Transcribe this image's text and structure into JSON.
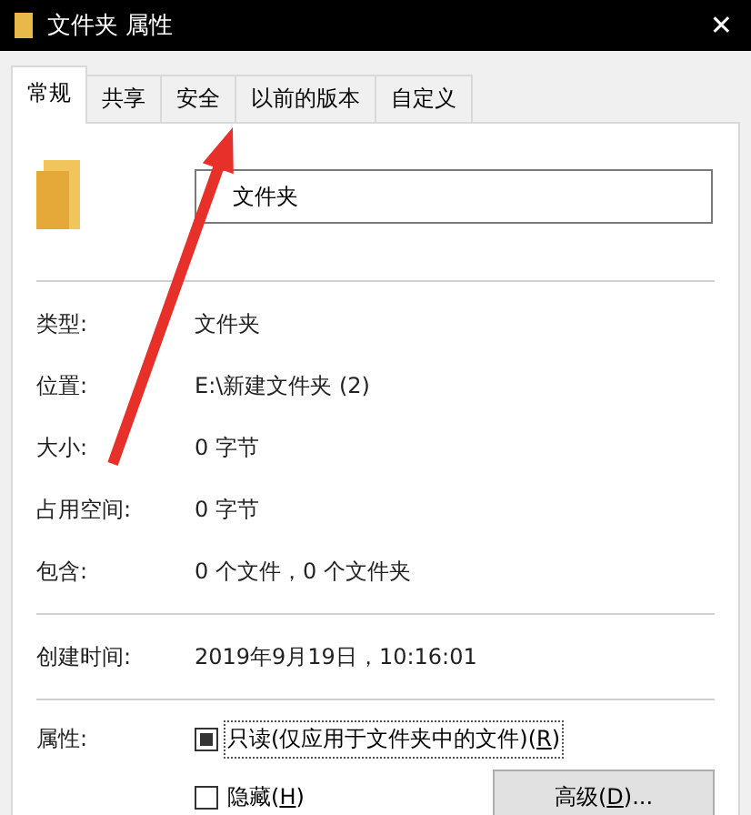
{
  "window": {
    "title": "文件夹 属性",
    "close": "✕"
  },
  "tabs": [
    {
      "label": "常规",
      "selected": true
    },
    {
      "label": "共享",
      "selected": false
    },
    {
      "label": "安全",
      "selected": false
    },
    {
      "label": "以前的版本",
      "selected": false
    },
    {
      "label": "自定义",
      "selected": false
    }
  ],
  "name_field": {
    "value": "文件夹"
  },
  "groups": [
    [
      {
        "label": "类型:",
        "value": "文件夹"
      },
      {
        "label": "位置:",
        "value": "E:\\新建文件夹 (2)"
      },
      {
        "label": "大小:",
        "value": "0 字节"
      },
      {
        "label": "占用空间:",
        "value": "0 字节"
      },
      {
        "label": "包含:",
        "value": "0 个文件，0 个文件夹"
      }
    ],
    [
      {
        "label": "创建时间:",
        "value": "2019年9月19日，10:16:01"
      }
    ]
  ],
  "attributes": {
    "label": "属性:",
    "options": [
      {
        "text": "只读(仅应用于文件夹中的文件)(",
        "key": "R",
        "text_end": ")",
        "checked": false,
        "indeterminate": true,
        "focused": true
      },
      {
        "text": "隐藏(",
        "key": "H",
        "text_end": ")",
        "checked": false,
        "indeterminate": false,
        "focused": false
      }
    ],
    "advanced_button": {
      "text": "高级(",
      "key": "D",
      "text_end": ")..."
    }
  }
}
